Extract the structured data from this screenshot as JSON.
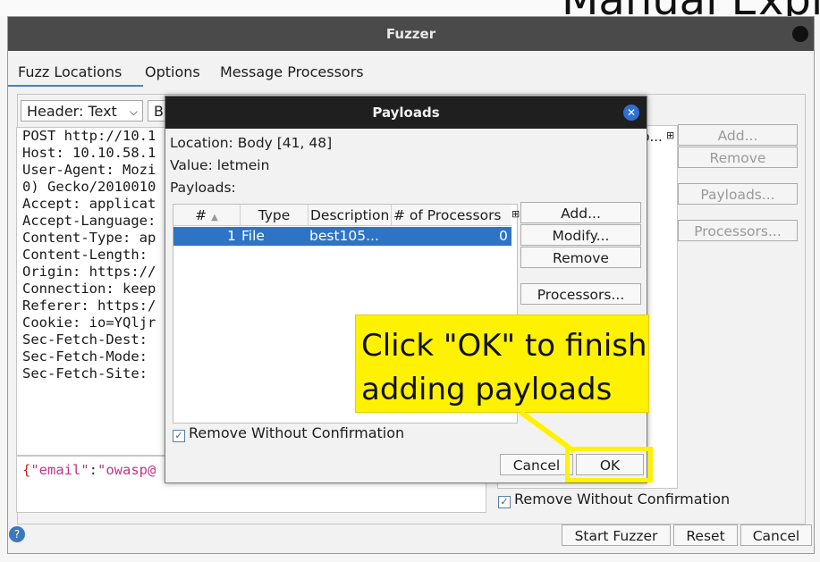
{
  "background": {
    "heading_fragment": "Manual Expl"
  },
  "fuzzer": {
    "title": "Fuzzer",
    "tabs": [
      "Fuzz Locations",
      "Options",
      "Message Processors"
    ],
    "header_select": "Header: Text",
    "body_select": "B",
    "request_lines": [
      "POST http://10.1",
      "Host: 10.10.58.1",
      "User-Agent: Mozi",
      "0) Gecko/2010010",
      "Accept: applicat",
      "Accept-Language:",
      "Content-Type: ap",
      "Content-Length:",
      "Origin: https://",
      "Connection: keep",
      "Referer: https:/",
      "Cookie: io=YQljr",
      "Sec-Fetch-Dest:",
      "Sec-Fetch-Mode:",
      "Sec-Fetch-Site:"
    ],
    "body": {
      "brace": "{",
      "key": "\"email\"",
      "colon": ":",
      "value": "\"owasp@"
    },
    "locations_header_fragment": "p...",
    "buttons": {
      "add": "Add...",
      "remove": "Remove",
      "payloads": "Payloads...",
      "processors": "Processors..."
    },
    "remove_without_confirmation": "Remove Without Confirmation",
    "bottom_buttons": {
      "start": "Start Fuzzer",
      "reset": "Reset",
      "cancel": "Cancel"
    },
    "help_icon": "?"
  },
  "payloads_dialog": {
    "title": "Payloads",
    "location": "Location: Body [41, 48]",
    "value": "Value: letmein",
    "payloads_label": "Payloads:",
    "columns": [
      "#",
      "Type",
      "Description",
      "# of Processors"
    ],
    "rows": [
      {
        "num": "1",
        "type": "File",
        "description": "best105...",
        "processors": "0"
      }
    ],
    "buttons": {
      "add": "Add...",
      "modify": "Modify...",
      "remove": "Remove",
      "processors": "Processors..."
    },
    "remove_without_confirmation": "Remove Without Confirmation",
    "cancel": "Cancel",
    "ok": "OK"
  },
  "callout": {
    "line1": "Click \"OK\" to finish",
    "line2": "adding payloads"
  },
  "colors": {
    "accent": "#2f73c4",
    "callout": "#fff200",
    "title_bar": "#4a4a4a"
  }
}
